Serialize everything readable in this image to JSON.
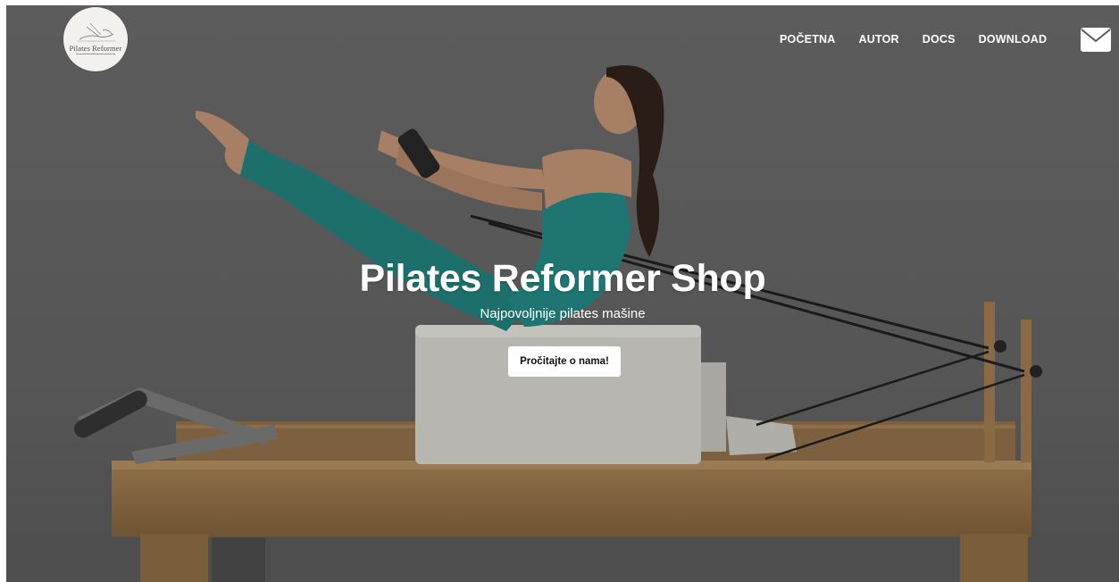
{
  "brand": {
    "logo_text": "Pilates Reformer",
    "logo_icon": "reformer-sketch-icon"
  },
  "nav": {
    "items": [
      {
        "label": "POČETNA"
      },
      {
        "label": "AUTOR"
      },
      {
        "label": "DOCS"
      },
      {
        "label": "DOWNLOAD"
      }
    ],
    "contact_icon": "envelope-icon"
  },
  "hero": {
    "title": "Pilates Reformer Shop",
    "subtitle": "Najpovoljnije pilates mašine",
    "cta_label": "Pročitajte o nama!",
    "background_icon": "pilates-reformer-photo"
  },
  "colors": {
    "nav_text": "#ffffff",
    "hero_text": "#ffffff",
    "button_bg": "#ffffff",
    "button_text": "#111111",
    "backdrop": "#5a5a5a",
    "wood": "#8a6a44",
    "outfit": "#1d6f6b"
  }
}
